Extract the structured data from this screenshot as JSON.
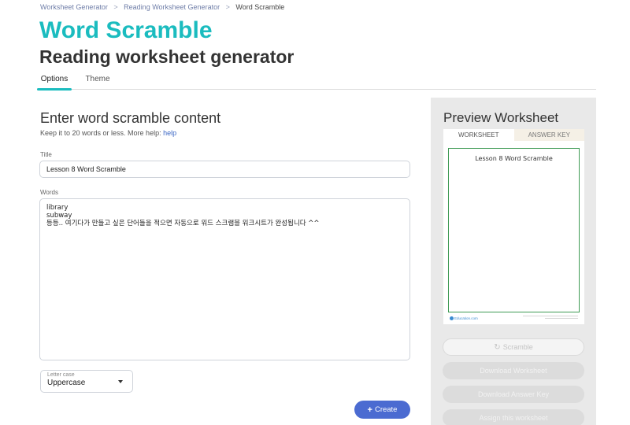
{
  "breadcrumb": {
    "items": [
      "Worksheet Generator",
      "Reading Worksheet Generator",
      "Word Scramble"
    ],
    "separator": ">"
  },
  "header": {
    "title": "Word Scramble",
    "subtitle": "Reading worksheet generator"
  },
  "tabs": [
    {
      "label": "Options",
      "active": true
    },
    {
      "label": "Theme",
      "active": false
    }
  ],
  "form": {
    "section_title": "Enter word scramble content",
    "help_text": "Keep it to 20 words or less. More help:",
    "help_link": "help",
    "title_label": "Title",
    "title_value": "Lesson 8 Word Scramble",
    "words_label": "Words",
    "words_value": "library\nsubway\n등등.. 여기다가 만들고 싶은 단어들을 적으면 자동으로 워드 스크램블 워크시트가 완성됩니다 ^^",
    "letter_case_label": "Letter case",
    "letter_case_value": "Uppercase",
    "create_label": "Create"
  },
  "preview": {
    "title": "Preview Worksheet",
    "tabs": [
      {
        "label": "WORKSHEET",
        "active": true
      },
      {
        "label": "ANSWER KEY",
        "active": false
      }
    ],
    "paper_title": "Lesson 8 Word Scramble",
    "footer_brand": "Education.com",
    "scramble_label": "Scramble",
    "download_worksheet_label": "Download Worksheet",
    "download_answer_key_label": "Download Answer Key",
    "assign_label": "Assign this worksheet"
  },
  "colors": {
    "accent": "#1bbcbf",
    "button_primary": "#4b6bd1",
    "paper_frame": "#3f9b55",
    "panel_bg": "#e9e9e9"
  },
  "icons": {
    "breadcrumb_separator": "chevron-right-icon",
    "create": "plus-icon",
    "scramble": "refresh-icon",
    "select": "caret-down-icon"
  }
}
